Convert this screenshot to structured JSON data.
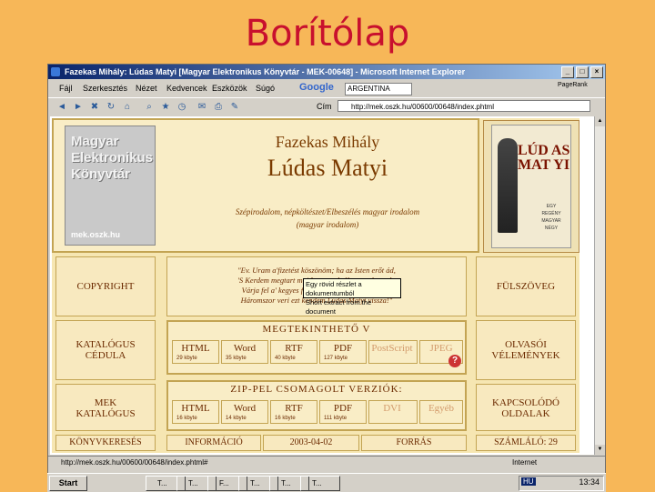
{
  "slide": {
    "title": "Borítólap"
  },
  "window": {
    "title": "Fazekas Mihály: Lúdas Matyi [Magyar Elektronikus Könyvtár - MEK-00648] - Microsoft Internet Explorer",
    "buttons": [
      "_",
      "□",
      "×"
    ]
  },
  "menu": {
    "items": [
      "Fájl",
      "Szerkesztés",
      "Nézet",
      "Kedvencek",
      "Eszközök",
      "Súgó"
    ],
    "google_label": "Google",
    "search_value": "ARGENTINA",
    "pagerank_label": "PageRank"
  },
  "toolbar": {
    "address_label": "Cím",
    "address_value": "http://mek.oszk.hu/00600/00648/index.phtml"
  },
  "page": {
    "logo": {
      "line1": "Magyar",
      "line2": "Elektronikus",
      "line3": "Könyvtár",
      "line4": "mek.oszk.hu"
    },
    "author": "Fazekas Mihály",
    "title": "Lúdas Matyi",
    "genre1": "Szépirodalom, népköltészet/Elbeszélés magyar irodalom",
    "genre2": "(magyar irodalom)",
    "cover": {
      "title": "LÚD AS MAT YI",
      "line1": "EGY",
      "line2": "REGÉNY",
      "line3": "MAGYAR",
      "line4": "NÉGY"
    },
    "quote": [
      "\"Ev. Uram a'fizetést köszönöm; ha az Isten erőt ád,",
      "'S Kerdem megtart majd megszolgálom: azért tsak:",
      "Várja fel a' kegyes fel fájára, hogy el ne felejtse:",
      "Háromszor veri ezt kendem Lúdas Matyi vissza!\""
    ],
    "left": {
      "copyright": "COPYRIGHT",
      "catalog1": "KATALÓGUS",
      "catalog2": "CÉDULA",
      "mek1": "MEK",
      "mek2": "KATALÓGUS",
      "search": "KÖNYVKERESÉS"
    },
    "right": {
      "flap": "FÜLSZÖVEG",
      "reviews1": "OLVASÓI",
      "reviews2": "VÉLEMÉNYEK",
      "related1": "KAPCSOLÓDÓ",
      "related2": "OLDALAK",
      "counter": "SZÁMLÁLÓ: 29"
    },
    "viewable": {
      "heading": "MEGTEKINTHETŐ V",
      "formats": [
        {
          "name": "HTML",
          "size": "29 kbyte"
        },
        {
          "name": "Word",
          "size": "35 kbyte"
        },
        {
          "name": "RTF",
          "size": "40 kbyte"
        },
        {
          "name": "PDF",
          "size": "127 kbyte"
        },
        {
          "name": "PostScript",
          "size": ""
        },
        {
          "name": "JPEG",
          "size": ""
        }
      ]
    },
    "zipped": {
      "heading": "ZIP-PEL CSOMAGOLT VERZIÓK:",
      "formats": [
        {
          "name": "HTML",
          "size": "16 kbyte"
        },
        {
          "name": "Word",
          "size": "14 kbyte"
        },
        {
          "name": "RTF",
          "size": "16 kbyte"
        },
        {
          "name": "PDF",
          "size": "111 kbyte"
        },
        {
          "name": "DVI",
          "size": ""
        },
        {
          "name": "Egyéb",
          "size": ""
        }
      ]
    },
    "bottom": {
      "info": "INFORMÁCIÓ",
      "date": "2003-04-02",
      "source": "FORRÁS"
    },
    "tooltip": {
      "line1": "Egy rövid részlet a dokumentumból",
      "line2": "Short extract from the document"
    },
    "help": "?"
  },
  "status": {
    "url": "http://mek.oszk.hu/00600/00648/index.phtml#",
    "zone": "Internet"
  },
  "taskbar": {
    "start": "Start",
    "tasks": [
      "T...",
      "T...",
      "F...",
      "T...",
      "T...",
      "T..."
    ],
    "lang": "HU",
    "clock": "13:34"
  }
}
